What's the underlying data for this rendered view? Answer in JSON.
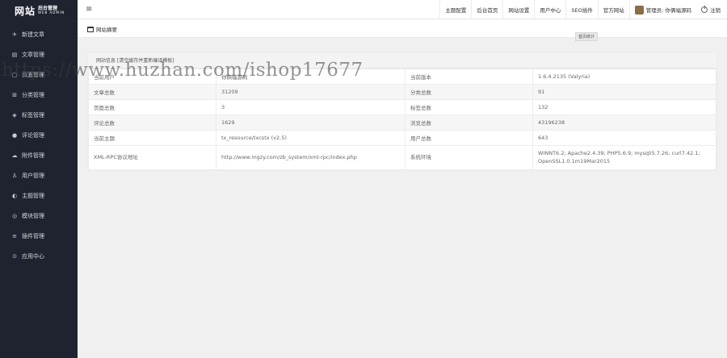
{
  "logo": {
    "main": "网站",
    "sub1": "后台管理",
    "sub2": "WEB ADMIN"
  },
  "sidebar": {
    "items": [
      {
        "icon": "paper-plane-icon",
        "glyph": "✈",
        "label": "新建文章"
      },
      {
        "icon": "document-icon",
        "glyph": "▤",
        "label": "文章管理"
      },
      {
        "icon": "page-icon",
        "glyph": "▢",
        "label": "页面管理"
      },
      {
        "icon": "category-icon",
        "glyph": "⊞",
        "label": "分类管理"
      },
      {
        "icon": "tag-icon",
        "glyph": "◈",
        "label": "标签管理"
      },
      {
        "icon": "comment-icon",
        "glyph": "●",
        "label": "评论管理"
      },
      {
        "icon": "cloud-icon",
        "glyph": "☁",
        "label": "附件管理"
      },
      {
        "icon": "user-icon",
        "glyph": "♙",
        "label": "用户管理"
      },
      {
        "icon": "theme-icon",
        "glyph": "◐",
        "label": "主题管理"
      },
      {
        "icon": "module-icon",
        "glyph": "◎",
        "label": "模块管理"
      },
      {
        "icon": "plugin-icon",
        "glyph": "≡",
        "label": "插件管理"
      },
      {
        "icon": "app-icon",
        "glyph": "⊙",
        "label": "应用中心"
      }
    ]
  },
  "topbar": {
    "menu_glyph": "≡",
    "tabs": [
      "主题配置",
      "后台首页",
      "网站设置",
      "用户中心",
      "SEO插件",
      "官方网站"
    ],
    "user_label": "管理员: 你俩福源码",
    "logout_label": "注销"
  },
  "breadcrumb": {
    "label": "网站摘要"
  },
  "tooltip": "首页统计",
  "panel": {
    "title": "网站信息 [清空缓存并重新编译模板]",
    "rows": [
      [
        "当前用户",
        "你俩福源码",
        "当前版本",
        "1.6.4.2135 (Valyria)"
      ],
      [
        "文章总数",
        "31209",
        "分类总数",
        "91"
      ],
      [
        "页面总数",
        "3",
        "标签总数",
        "132"
      ],
      [
        "评论总数",
        "1629",
        "浏览总数",
        "43196238"
      ],
      [
        "当前主题",
        "tx_resource/txcstx (v2.5)",
        "用户总数",
        "643"
      ],
      [
        "XML-RPC协议地址",
        "http://www.mgzy.com/zb_system/xml-rpc/index.php",
        "系统环境",
        "WINNT6.2; Apache2.4.39; PHP5.6.9; mysqli5.7.26; curl7.42.1; OpenSSL1.0.1m19Mar2015"
      ]
    ]
  },
  "watermark": "https://www.huzhan.com/ishop17677"
}
